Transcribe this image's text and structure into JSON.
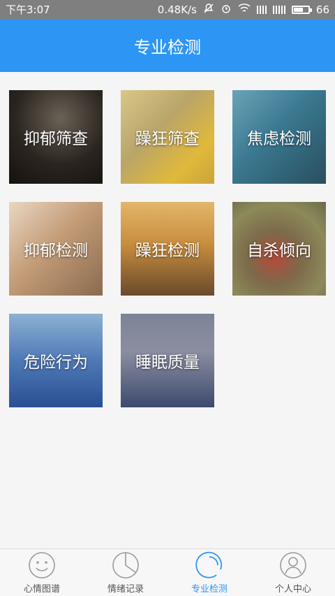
{
  "status_bar": {
    "time": "下午3:07",
    "network_speed": "0.48K/s",
    "battery_level": "66"
  },
  "header": {
    "title": "专业检测"
  },
  "tests": [
    {
      "label": "抑郁筛查"
    },
    {
      "label": "躁狂筛查"
    },
    {
      "label": "焦虑检测"
    },
    {
      "label": "抑郁检测"
    },
    {
      "label": "躁狂检测"
    },
    {
      "label": "自杀倾向"
    },
    {
      "label": "危险行为"
    },
    {
      "label": "睡眠质量"
    }
  ],
  "tab_bar": {
    "items": [
      {
        "label": "心情图谱",
        "icon": "smiley-face-icon"
      },
      {
        "label": "情绪记录",
        "icon": "pie-chart-icon"
      },
      {
        "label": "专业检测",
        "icon": "detection-icon",
        "active": true
      },
      {
        "label": "个人中心",
        "icon": "person-icon"
      }
    ],
    "active_color": "#2d96f4"
  },
  "colors": {
    "header": "#2d96f4",
    "status_bar": "#7f7f7f"
  }
}
